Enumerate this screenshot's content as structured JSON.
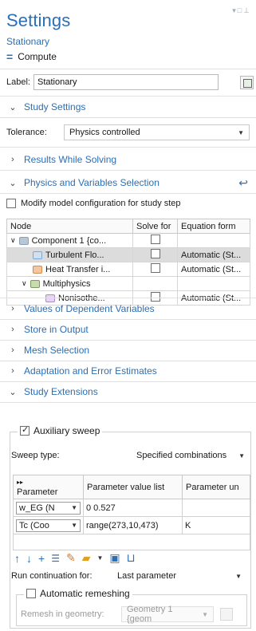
{
  "header": {
    "title": "Settings",
    "subtitle": "Stationary",
    "compute_label": "Compute"
  },
  "label_row": {
    "label": "Label:",
    "value": "Stationary"
  },
  "sections": {
    "study_settings": "Study Settings",
    "results_while_solving": "Results While Solving",
    "physics_and_variables": "Physics and Variables Selection",
    "values_dependent": "Values of Dependent Variables",
    "store_output": "Store in Output",
    "mesh_selection": "Mesh Selection",
    "adaptation": "Adaptation and Error Estimates",
    "study_extensions": "Study Extensions"
  },
  "tolerance": {
    "label": "Tolerance:",
    "value": "Physics controlled"
  },
  "modify_model_label": "Modify model configuration for study step",
  "node_table": {
    "headers": [
      "Node",
      "Solve for",
      "Equation form"
    ],
    "rows": [
      {
        "node": "Component 1 {co...",
        "eq": "",
        "indent": 0,
        "icon": "component-icon",
        "expand": "∨"
      },
      {
        "node": "Turbulent Flo...",
        "eq": "Automatic (St...",
        "indent": 2,
        "icon": "turbulent-flow-icon",
        "expand": ""
      },
      {
        "node": "Heat Transfer i...",
        "eq": "Automatic (St...",
        "indent": 2,
        "icon": "heat-transfer-icon",
        "expand": ""
      },
      {
        "node": "Multiphysics",
        "eq": "",
        "indent": 1,
        "icon": "multiphysics-icon",
        "expand": "∨"
      },
      {
        "node": "Nonisothe...",
        "eq": "Automatic (St...",
        "indent": 3,
        "icon": "nonisothermal-icon",
        "expand": ""
      }
    ]
  },
  "auxiliary_sweep": {
    "label": "Auxiliary sweep",
    "sweep_type_label": "Sweep type:",
    "sweep_type_value": "Specified combinations",
    "headers": [
      "Parameter",
      "Parameter value list",
      "Parameter un"
    ],
    "rows": [
      {
        "param": "w_EG (N",
        "values": "0 0.527",
        "unit": ""
      },
      {
        "param": "Tc (Coo",
        "values": "range(273,10,473)",
        "unit": "K"
      }
    ],
    "run_continuation_label": "Run continuation for:",
    "run_continuation_value": "Last parameter",
    "auto_remesh_label": "Automatic remeshing",
    "remesh_geom_label": "Remesh in geometry:",
    "remesh_geom_value": "Geometry 1 {geom"
  },
  "colors": {
    "accent": "#2b6fb6",
    "selected_row": "#dcdcdc"
  }
}
